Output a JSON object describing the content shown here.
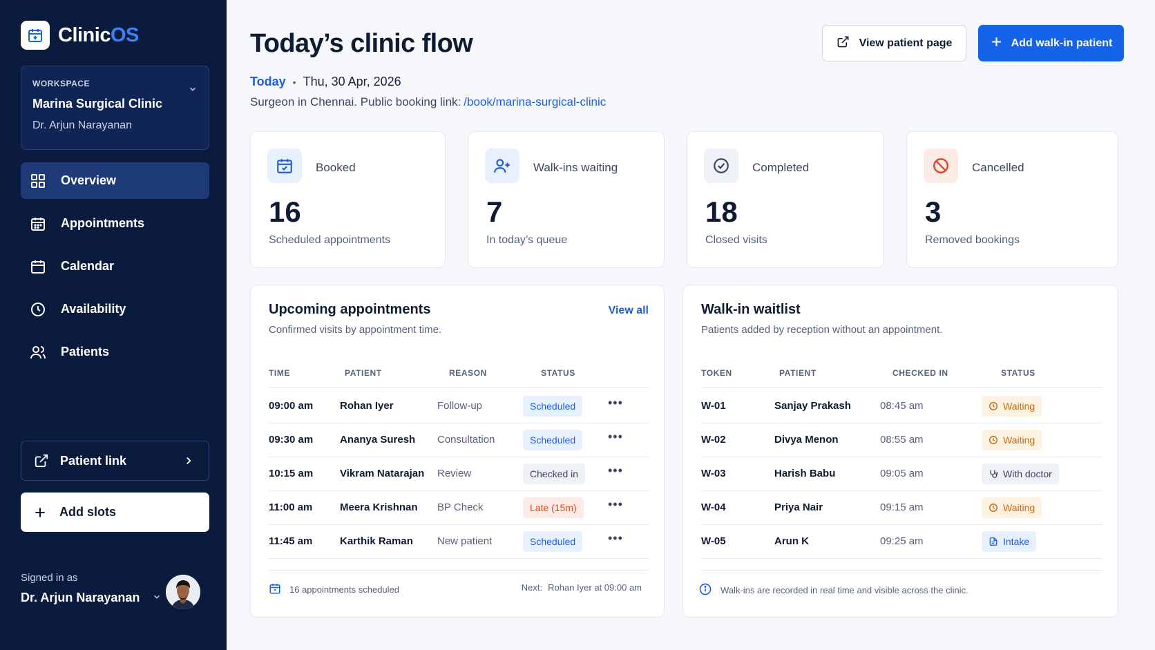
{
  "brand": {
    "name_main": "Clinic",
    "name_accent": "OS"
  },
  "workspace": {
    "caption": "WORKSPACE",
    "name": "Marina Surgical Clinic",
    "doctor": "Dr. Arjun Narayanan"
  },
  "nav": [
    {
      "label": "Overview",
      "icon": "grid-icon",
      "active": true
    },
    {
      "label": "Appointments",
      "icon": "calendar-grid-icon"
    },
    {
      "label": "Calendar",
      "icon": "calendar-icon"
    },
    {
      "label": "Availability",
      "icon": "clock-icon"
    },
    {
      "label": "Patients",
      "icon": "users-icon"
    }
  ],
  "sidebar_actions": {
    "patient_link": "Patient link",
    "add_slots": "Add slots"
  },
  "user": {
    "signed_label": "Signed in as",
    "name": "Dr. Arjun Narayanan"
  },
  "header": {
    "title": "Today’s clinic flow",
    "today": "Today",
    "date": "Thu, 30 Apr, 2026",
    "subtitle": "Surgeon in Chennai. Public booking link:",
    "booking_link": "/book/marina-surgical-clinic",
    "view_patient_page": "View patient page",
    "add_walkin": "Add walk-in patient"
  },
  "stats": [
    {
      "label": "Booked",
      "value": "16",
      "desc": "Scheduled appointments",
      "icon": "calendar-check-icon",
      "color": "#1f5fd8"
    },
    {
      "label": "Walk-ins waiting",
      "value": "7",
      "desc": "In today’s queue",
      "icon": "user-plus-icon",
      "color": "#1f5fd8"
    },
    {
      "label": "Completed",
      "value": "18",
      "desc": "Closed visits",
      "icon": "check-circle-icon",
      "color": "#3b4560"
    },
    {
      "label": "Cancelled",
      "value": "3",
      "desc": "Removed bookings",
      "icon": "ban-icon",
      "color": "#e0452b"
    }
  ],
  "upcoming": {
    "title": "Upcoming appointments",
    "subtitle": "Confirmed visits by appointment time.",
    "view_all": "View all",
    "columns": [
      "TIME",
      "PATIENT",
      "REASON",
      "STATUS"
    ],
    "rows": [
      {
        "time": "09:00 am",
        "patient": "Rohan Iyer",
        "reason": "Follow-up",
        "status": "Scheduled",
        "tone": "blue"
      },
      {
        "time": "09:30 am",
        "patient": "Ananya Suresh",
        "reason": "Consultation",
        "status": "Scheduled",
        "tone": "blue"
      },
      {
        "time": "10:15 am",
        "patient": "Vikram Natarajan",
        "reason": "Review",
        "status": "Checked in",
        "tone": "gray"
      },
      {
        "time": "11:00 am",
        "patient": "Meera Krishnan",
        "reason": "BP Check",
        "status": "Late (15m)",
        "tone": "red"
      },
      {
        "time": "11:45 am",
        "patient": "Karthik Raman",
        "reason": "New patient",
        "status": "Scheduled",
        "tone": "blue"
      }
    ],
    "footer_count": "16 appointments scheduled",
    "footer_next_label": "Next:",
    "footer_next": "Rohan Iyer at 09:00 am"
  },
  "waitlist": {
    "title": "Walk-in waitlist",
    "subtitle": "Patients added by reception without an appointment.",
    "columns": [
      "TOKEN",
      "PATIENT",
      "CHECKED IN",
      "STATUS"
    ],
    "rows": [
      {
        "token": "W-01",
        "patient": "Sanjay Prakash",
        "checked_in": "08:45 am",
        "status": "Waiting",
        "tone": "amber",
        "icon": "clock-icon"
      },
      {
        "token": "W-02",
        "patient": "Divya Menon",
        "checked_in": "08:55 am",
        "status": "Waiting",
        "tone": "amber",
        "icon": "clock-icon"
      },
      {
        "token": "W-03",
        "patient": "Harish Babu",
        "checked_in": "09:05 am",
        "status": "With doctor",
        "tone": "gray",
        "icon": "stethoscope-icon"
      },
      {
        "token": "W-04",
        "patient": "Priya Nair",
        "checked_in": "09:15 am",
        "status": "Waiting",
        "tone": "amber",
        "icon": "clock-icon"
      },
      {
        "token": "W-05",
        "patient": "Arun K",
        "checked_in": "09:25 am",
        "status": "Intake",
        "tone": "blue",
        "icon": "document-icon"
      }
    ],
    "footer_note": "Walk-ins are recorded in real time and visible across the clinic."
  }
}
